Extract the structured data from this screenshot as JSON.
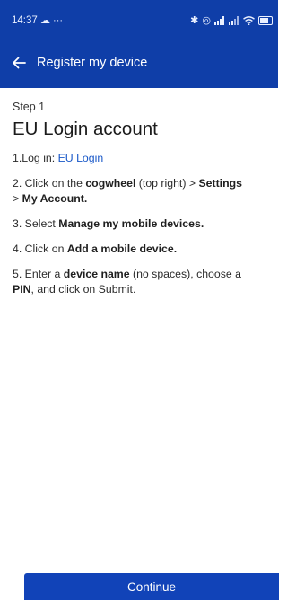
{
  "status_bar": {
    "time": "14:37",
    "left_icons": "☁ ···",
    "right_icons": [
      "bluetooth-icon",
      "alarm-icon",
      "signal-icon",
      "signal-icon-2",
      "wifi-icon",
      "battery-icon"
    ],
    "battery_level": "74"
  },
  "toolbar": {
    "back_icon": "arrow-left-icon",
    "title": "Register my device"
  },
  "content": {
    "step_label": "Step 1",
    "heading": "EU Login account",
    "step1": {
      "prefix": "1.Log in: ",
      "link": "EU Login"
    },
    "step2": {
      "line1_pre": "2. Click on the ",
      "line1_bold1": "cogwheel",
      "line1_mid": " (top right) > ",
      "line1_bold2": "Settings",
      "line2_pre": "> ",
      "line2_bold": "My Account."
    },
    "step3": {
      "pre": "3. Select ",
      "bold": "Manage my mobile devices."
    },
    "step4": {
      "pre": "4. Click on ",
      "bold": "Add a mobile device."
    },
    "step5": {
      "line1_pre": "5. Enter a ",
      "line1_bold": "device name",
      "line1_post": " (no spaces), choose a",
      "line2_bold": "PIN",
      "line2_post": ", and click on Submit."
    }
  },
  "footer": {
    "continue_label": "Continue"
  },
  "colors": {
    "appbar": "#0f3ea8",
    "button": "#1143b8",
    "link": "#1958c8"
  }
}
